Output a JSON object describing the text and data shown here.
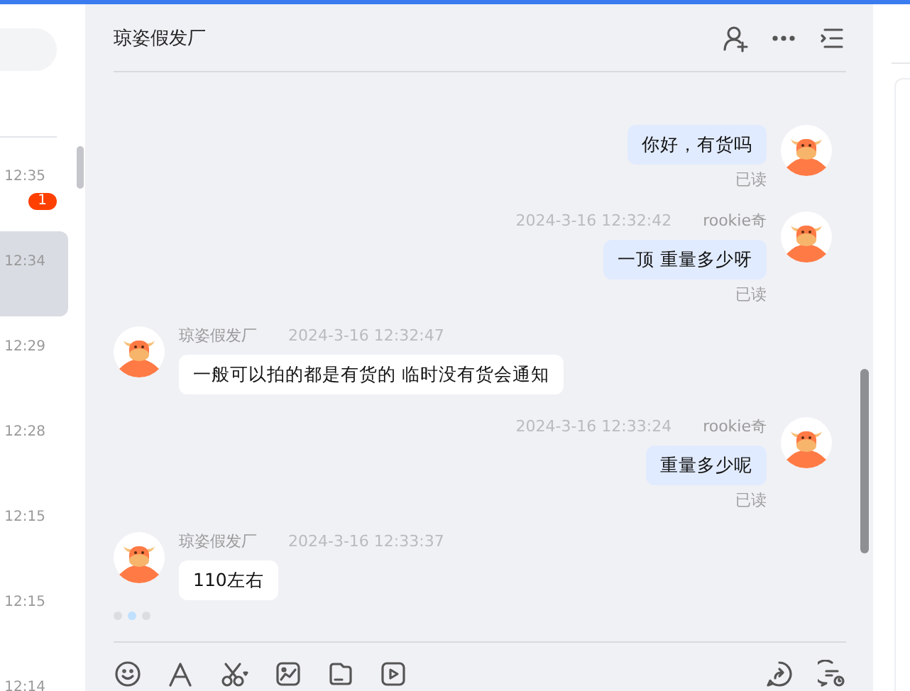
{
  "sidebar": {
    "conversations": [
      {
        "time": "12:35",
        "unread": "1",
        "selected": false
      },
      {
        "time": "12:34",
        "selected": true
      },
      {
        "time": "12:29",
        "selected": false
      },
      {
        "time": "12:28",
        "selected": false
      },
      {
        "time": "12:15",
        "selected": false
      },
      {
        "time": "12:15",
        "selected": false
      },
      {
        "time": "12:14",
        "selected": false
      }
    ]
  },
  "chat": {
    "title": "琼姿假发厂",
    "messages": [
      {
        "kind": "mine",
        "text": "你好，有货吗",
        "status": "已读"
      },
      {
        "kind": "mine",
        "sender": "rookie奇",
        "time": "2024-3-16 12:32:42",
        "text": "一顶 重量多少呀",
        "status": "已读"
      },
      {
        "kind": "theirs",
        "sender": "琼姿假发厂",
        "time": "2024-3-16 12:32:47",
        "text": "一般可以拍的都是有货的 临时没有货会通知"
      },
      {
        "kind": "mine",
        "sender": "rookie奇",
        "time": "2024-3-16 12:33:24",
        "text": "重量多少呢",
        "status": "已读"
      },
      {
        "kind": "theirs",
        "sender": "琼姿假发厂",
        "time": "2024-3-16 12:33:37",
        "text": "110左右"
      }
    ]
  }
}
